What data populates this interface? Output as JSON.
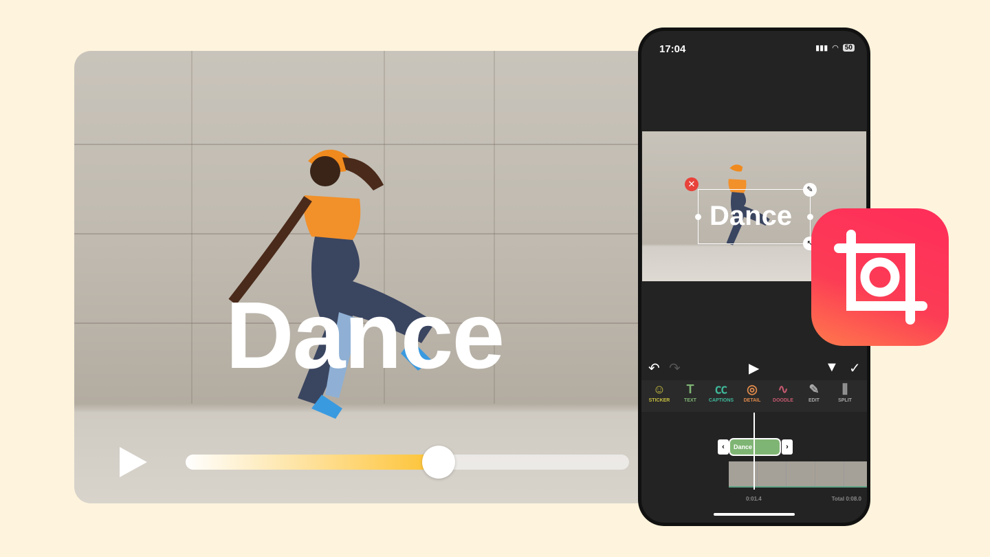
{
  "hero": {
    "title": "Dance",
    "progress_percent": 57
  },
  "phone": {
    "status": {
      "time": "17:04",
      "battery": "50"
    },
    "preview": {
      "text": "Dance"
    },
    "toolbar": [
      {
        "label": "STICKER",
        "icon": "smiley-plus-icon",
        "color": "#c8c040",
        "glyph": "☺"
      },
      {
        "label": "TEXT",
        "icon": "text-plus-icon",
        "color": "#7fb574",
        "glyph": "T"
      },
      {
        "label": "CAPTIONS",
        "icon": "captions-plus-icon",
        "color": "#3fb89a",
        "glyph": "㏄"
      },
      {
        "label": "DETAIL",
        "icon": "focus-plus-icon",
        "color": "#e08a4c",
        "glyph": "◎"
      },
      {
        "label": "DOODLE",
        "icon": "squiggle-plus-icon",
        "color": "#c85a70",
        "glyph": "∿"
      },
      {
        "label": "EDIT",
        "icon": "pencil-icon",
        "color": "#aaaaaa",
        "glyph": "✎"
      },
      {
        "label": "SPLIT",
        "icon": "split-icon",
        "color": "#aaaaaa",
        "glyph": "⫼"
      }
    ],
    "timeline": {
      "clip_label": "Dance",
      "current_time": "0:01.4",
      "total": "Total 0:08.0"
    }
  },
  "colors": {
    "background": "#fef3dc",
    "accent": "#fdc232",
    "clip": "#7fb574",
    "app_icon": "#ff2d5a"
  }
}
